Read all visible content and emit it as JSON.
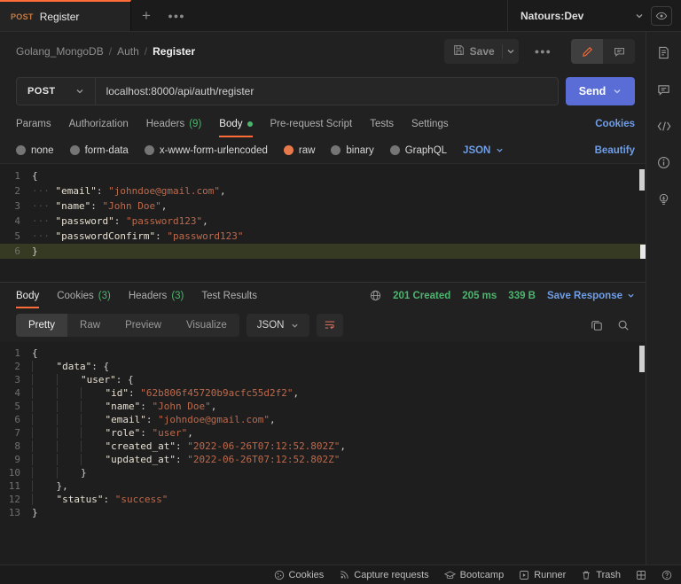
{
  "colors": {
    "accent_orange": "#ff6c37",
    "method_orange": "#c77b40",
    "selected_radio_orange": "#e8794a",
    "status_green": "#4db56f",
    "link_blue": "#6e9ee8",
    "send_blue": "#5a6dd6",
    "code_key": "#e7e0d2",
    "code_string": "#bd6a4d",
    "line_highlight": "#363a22"
  },
  "topbar": {
    "tab_method": "POST",
    "tab_title": "Register",
    "environment": "Natours:Dev"
  },
  "breadcrumb": {
    "collection": "Golang_MongoDB",
    "folder": "Auth",
    "request": "Register",
    "separator": "/"
  },
  "header_actions": {
    "save_label": "Save"
  },
  "request": {
    "method": "POST",
    "url": "localhost:8000/api/auth/register",
    "send_label": "Send",
    "tabs": [
      {
        "label": "Params"
      },
      {
        "label": "Authorization"
      },
      {
        "label": "Headers",
        "count": "(9)"
      },
      {
        "label": "Body"
      },
      {
        "label": "Pre-request Script"
      },
      {
        "label": "Tests"
      },
      {
        "label": "Settings"
      }
    ],
    "active_tab": "Body",
    "cookies_link": "Cookies",
    "modes": [
      {
        "label": "none"
      },
      {
        "label": "form-data"
      },
      {
        "label": "x-www-form-urlencoded"
      },
      {
        "label": "raw"
      },
      {
        "label": "binary"
      },
      {
        "label": "GraphQL"
      }
    ],
    "selected_mode": "raw",
    "language": "JSON",
    "beautify_link": "Beautify",
    "body_lines": [
      {
        "n": 1,
        "i": 0,
        "t": [
          [
            "{",
            "p"
          ]
        ]
      },
      {
        "n": 2,
        "i": 1,
        "t": [
          [
            "\"email\"",
            "k"
          ],
          [
            ": ",
            "p"
          ],
          [
            "\"johndoe@gmail.com\"",
            "s"
          ],
          [
            ",",
            "p"
          ]
        ]
      },
      {
        "n": 3,
        "i": 1,
        "t": [
          [
            "\"name\"",
            "k"
          ],
          [
            ": ",
            "p"
          ],
          [
            "\"John Doe\"",
            "s"
          ],
          [
            ",",
            "p"
          ]
        ]
      },
      {
        "n": 4,
        "i": 1,
        "t": [
          [
            "\"password\"",
            "k"
          ],
          [
            ": ",
            "p"
          ],
          [
            "\"password123\"",
            "s"
          ],
          [
            ",",
            "p"
          ]
        ]
      },
      {
        "n": 5,
        "i": 1,
        "t": [
          [
            "\"passwordConfirm\"",
            "k"
          ],
          [
            ": ",
            "p"
          ],
          [
            "\"password123\"",
            "s"
          ]
        ]
      },
      {
        "n": 6,
        "i": 0,
        "t": [
          [
            "}",
            "p"
          ]
        ],
        "hl": true
      }
    ]
  },
  "response": {
    "tabs": [
      {
        "label": "Body"
      },
      {
        "label": "Cookies",
        "count": "(3)"
      },
      {
        "label": "Headers",
        "count": "(3)"
      },
      {
        "label": "Test Results"
      }
    ],
    "active_tab": "Body",
    "status": "201 Created",
    "time": "205 ms",
    "size": "339 B",
    "save_response_label": "Save Response",
    "view_tabs": [
      {
        "label": "Pretty"
      },
      {
        "label": "Raw"
      },
      {
        "label": "Preview"
      },
      {
        "label": "Visualize"
      }
    ],
    "active_view_tab": "Pretty",
    "language": "JSON",
    "body_lines": [
      {
        "n": 1,
        "i": 0,
        "t": [
          [
            "{",
            "p"
          ]
        ]
      },
      {
        "n": 2,
        "i": 1,
        "t": [
          [
            "\"data\"",
            "k"
          ],
          [
            ": ",
            "p"
          ],
          [
            "{",
            "p"
          ]
        ]
      },
      {
        "n": 3,
        "i": 2,
        "t": [
          [
            "\"user\"",
            "k"
          ],
          [
            ": ",
            "p"
          ],
          [
            "{",
            "p"
          ]
        ]
      },
      {
        "n": 4,
        "i": 3,
        "t": [
          [
            "\"id\"",
            "k"
          ],
          [
            ": ",
            "p"
          ],
          [
            "\"62b806f45720b9acfc55d2f2\"",
            "s"
          ],
          [
            ",",
            "p"
          ]
        ]
      },
      {
        "n": 5,
        "i": 3,
        "t": [
          [
            "\"name\"",
            "k"
          ],
          [
            ": ",
            "p"
          ],
          [
            "\"John Doe\"",
            "s"
          ],
          [
            ",",
            "p"
          ]
        ]
      },
      {
        "n": 6,
        "i": 3,
        "t": [
          [
            "\"email\"",
            "k"
          ],
          [
            ": ",
            "p"
          ],
          [
            "\"johndoe@gmail.com\"",
            "s"
          ],
          [
            ",",
            "p"
          ]
        ]
      },
      {
        "n": 7,
        "i": 3,
        "t": [
          [
            "\"role\"",
            "k"
          ],
          [
            ": ",
            "p"
          ],
          [
            "\"user\"",
            "s"
          ],
          [
            ",",
            "p"
          ]
        ]
      },
      {
        "n": 8,
        "i": 3,
        "t": [
          [
            "\"created_at\"",
            "k"
          ],
          [
            ": ",
            "p"
          ],
          [
            "\"2022-06-26T07:12:52.802Z\"",
            "s"
          ],
          [
            ",",
            "p"
          ]
        ]
      },
      {
        "n": 9,
        "i": 3,
        "t": [
          [
            "\"updated_at\"",
            "k"
          ],
          [
            ": ",
            "p"
          ],
          [
            "\"2022-06-26T07:12:52.802Z\"",
            "s"
          ]
        ]
      },
      {
        "n": 10,
        "i": 2,
        "t": [
          [
            "}",
            "p"
          ]
        ]
      },
      {
        "n": 11,
        "i": 1,
        "t": [
          [
            "},",
            "p"
          ]
        ]
      },
      {
        "n": 12,
        "i": 1,
        "t": [
          [
            "\"status\"",
            "k"
          ],
          [
            ": ",
            "p"
          ],
          [
            "\"success\"",
            "s"
          ]
        ]
      },
      {
        "n": 13,
        "i": 0,
        "t": [
          [
            "}",
            "p"
          ]
        ]
      }
    ]
  },
  "footer": {
    "items": [
      {
        "label": "Cookies"
      },
      {
        "label": "Capture requests"
      },
      {
        "label": "Bootcamp"
      },
      {
        "label": "Runner"
      },
      {
        "label": "Trash"
      }
    ]
  }
}
